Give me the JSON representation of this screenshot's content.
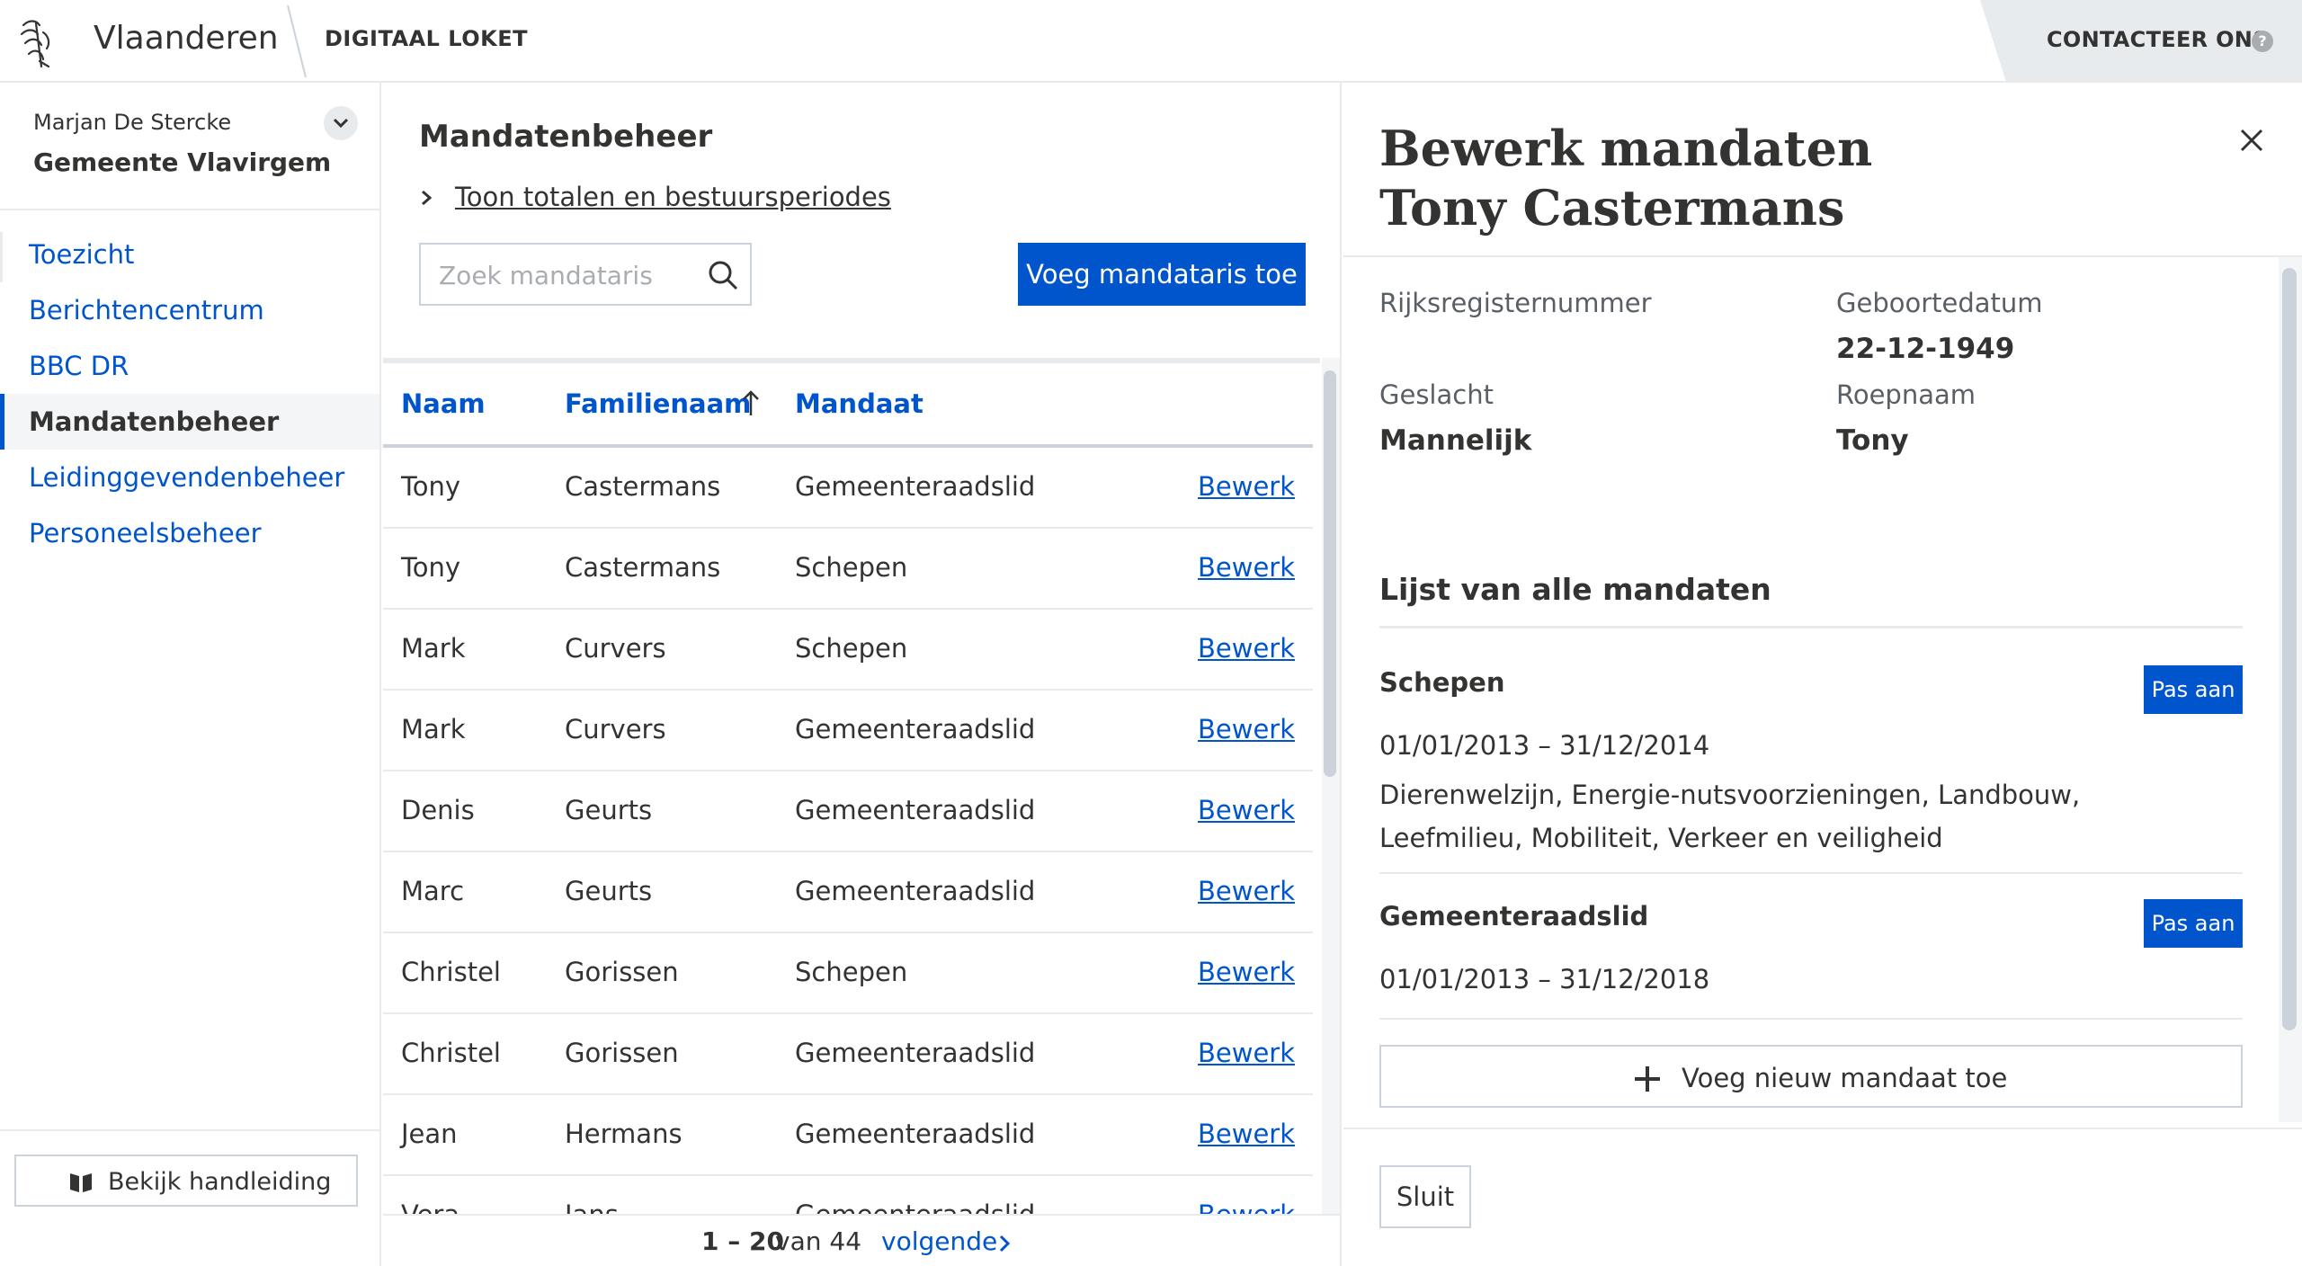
{
  "header": {
    "brand": "Vlaanderen",
    "subbrand": "DIGITAAL LOKET",
    "contact_label": "CONTACTEER ONS",
    "contact_help": "?",
    "logo_icon": "flemish-lion-icon"
  },
  "sidebar": {
    "user_name": "Marjan De Stercke",
    "org_name": "Gemeente Vlavirgem",
    "nav": [
      {
        "label": "Toezicht",
        "active": false
      },
      {
        "label": "Berichtencentrum",
        "active": false
      },
      {
        "label": "BBC DR",
        "active": false
      },
      {
        "label": "Mandatenbeheer",
        "active": true
      },
      {
        "label": "Leidinggevendenbeheer",
        "active": false
      },
      {
        "label": "Personeelsbeheer",
        "active": false
      }
    ],
    "manual_label": "Bekijk handleiding"
  },
  "main": {
    "title": "Mandatenbeheer",
    "totals_link": "Toon totalen en bestuursperiodes",
    "search_placeholder": "Zoek mandataris",
    "add_button": "Voeg mandataris toe",
    "columns": [
      "Naam",
      "Familienaam",
      "Mandaat"
    ],
    "sort_column": "Familienaam",
    "sort_direction": "ascending",
    "rows": [
      {
        "naam": "Tony",
        "familienaam": "Castermans",
        "mandaat": "Gemeenteraadslid",
        "action": "Bewerk"
      },
      {
        "naam": "Tony",
        "familienaam": "Castermans",
        "mandaat": "Schepen",
        "action": "Bewerk"
      },
      {
        "naam": "Mark",
        "familienaam": "Curvers",
        "mandaat": "Schepen",
        "action": "Bewerk"
      },
      {
        "naam": "Mark",
        "familienaam": "Curvers",
        "mandaat": "Gemeenteraadslid",
        "action": "Bewerk"
      },
      {
        "naam": "Denis",
        "familienaam": "Geurts",
        "mandaat": "Gemeenteraadslid",
        "action": "Bewerk"
      },
      {
        "naam": "Marc",
        "familienaam": "Geurts",
        "mandaat": "Gemeenteraadslid",
        "action": "Bewerk"
      },
      {
        "naam": "Christel",
        "familienaam": "Gorissen",
        "mandaat": "Schepen",
        "action": "Bewerk"
      },
      {
        "naam": "Christel",
        "familienaam": "Gorissen",
        "mandaat": "Gemeenteraadslid",
        "action": "Bewerk"
      },
      {
        "naam": "Jean",
        "familienaam": "Hermans",
        "mandaat": "Gemeenteraadslid",
        "action": "Bewerk"
      },
      {
        "naam": "Vera",
        "familienaam": "Jans",
        "mandaat": "Gemeenteraadslid",
        "action": "Bewerk"
      }
    ],
    "pagination": {
      "range": "1 – 20",
      "of": "van 44",
      "next": "volgende"
    }
  },
  "panel": {
    "title_line1": "Bewerk mandaten",
    "title_line2": "Tony Castermans",
    "fields": {
      "rijksregister_label": "Rijksregisternummer",
      "rijksregister_value": "",
      "geboortedatum_label": "Geboortedatum",
      "geboortedatum_value": "22-12-1949",
      "geslacht_label": "Geslacht",
      "geslacht_value": "Mannelijk",
      "roepnaam_label": "Roepnaam",
      "roepnaam_value": "Tony"
    },
    "list_title": "Lijst van alle mandaten",
    "mandates": [
      {
        "name": "Schepen",
        "edit_label": "Pas aan",
        "period": "01/01/2013 – 31/12/2014",
        "domains": "Dierenwelzijn, Energie-nutsvoorzieningen, Landbouw, Leefmilieu, Mobiliteit, Verkeer en veiligheid"
      },
      {
        "name": "Gemeenteraadslid",
        "edit_label": "Pas aan",
        "period": "01/01/2013 – 31/12/2018",
        "domains": ""
      }
    ],
    "add_mandate": "Voeg nieuw mandaat toe",
    "close_button": "Sluit"
  },
  "colors": {
    "primary": "#0055cc",
    "text": "#333332",
    "muted": "#5a5f66",
    "border": "#cbd2da",
    "light": "#e8ebee"
  }
}
